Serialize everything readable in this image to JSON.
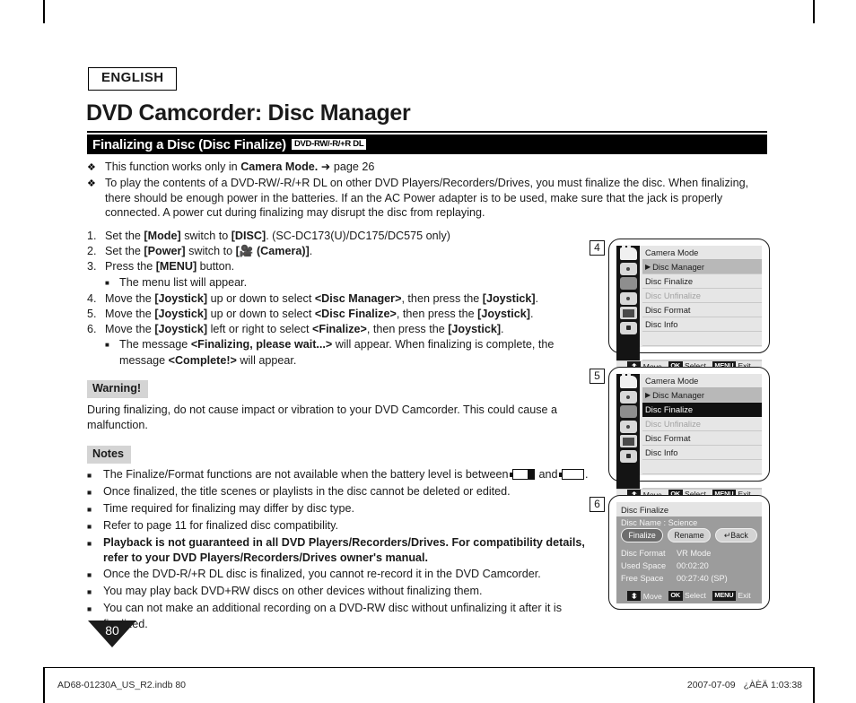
{
  "language_tag": "ENGLISH",
  "page_title": "DVD Camcorder: Disc Manager",
  "section": {
    "title": "Finalizing a Disc (Disc Finalize)",
    "disc_badge": "DVD-RW/-R/+R DL"
  },
  "intro": [
    {
      "parts": [
        {
          "t": "This function works only in ",
          "b": false
        },
        {
          "t": "Camera Mode.",
          "b": true
        },
        {
          "t": " ➜ page 26",
          "b": false
        }
      ]
    },
    {
      "parts": [
        {
          "t": "To play the contents of a DVD-RW/-R/+R DL on other DVD Players/Recorders/Drives, you must finalize the disc. When finalizing, there should be enough power in the batteries. If an the AC Power adapter is to be used, make sure that the jack is properly connected. A power cut during finalizing may disrupt the disc from replaying.",
          "b": false
        }
      ]
    }
  ],
  "steps": [
    {
      "num": "1.",
      "parts": [
        {
          "t": "Set the ",
          "b": false
        },
        {
          "t": "[Mode]",
          "b": true
        },
        {
          "t": " switch to ",
          "b": false
        },
        {
          "t": "[DISC]",
          "b": true
        },
        {
          "t": ". (SC-DC173(U)/DC175/DC575 only)",
          "b": false
        }
      ]
    },
    {
      "num": "2.",
      "parts": [
        {
          "t": "Set the ",
          "b": false
        },
        {
          "t": "[Power]",
          "b": true
        },
        {
          "t": " switch to ",
          "b": false
        },
        {
          "t": "[🎥 (Camera)]",
          "b": true
        },
        {
          "t": ".",
          "b": false
        }
      ]
    },
    {
      "num": "3.",
      "parts": [
        {
          "t": "Press the ",
          "b": false
        },
        {
          "t": "[MENU]",
          "b": true
        },
        {
          "t": " button.",
          "b": false
        }
      ],
      "sub": [
        {
          "parts": [
            {
              "t": "The menu list will appear.",
              "b": false
            }
          ]
        }
      ]
    },
    {
      "num": "4.",
      "parts": [
        {
          "t": "Move the ",
          "b": false
        },
        {
          "t": "[Joystick]",
          "b": true
        },
        {
          "t": " up or down to select ",
          "b": false
        },
        {
          "t": "<Disc Manager>",
          "b": true
        },
        {
          "t": ", then press the ",
          "b": false
        },
        {
          "t": "[Joystick]",
          "b": true
        },
        {
          "t": ".",
          "b": false
        }
      ]
    },
    {
      "num": "5.",
      "parts": [
        {
          "t": "Move the ",
          "b": false
        },
        {
          "t": "[Joystick]",
          "b": true
        },
        {
          "t": " up or down to select ",
          "b": false
        },
        {
          "t": "<Disc Finalize>",
          "b": true
        },
        {
          "t": ", then press the ",
          "b": false
        },
        {
          "t": "[Joystick]",
          "b": true
        },
        {
          "t": ".",
          "b": false
        }
      ]
    },
    {
      "num": "6.",
      "parts": [
        {
          "t": "Move the ",
          "b": false
        },
        {
          "t": "[Joystick]",
          "b": true
        },
        {
          "t": " left or right to select ",
          "b": false
        },
        {
          "t": "<Finalize>",
          "b": true
        },
        {
          "t": ", then press the ",
          "b": false
        },
        {
          "t": "[Joystick]",
          "b": true
        },
        {
          "t": ".",
          "b": false
        }
      ],
      "sub": [
        {
          "parts": [
            {
              "t": "The message ",
              "b": false
            },
            {
              "t": "<Finalizing, please wait...>",
              "b": true
            },
            {
              "t": " will appear. When finalizing is complete, the message ",
              "b": false
            },
            {
              "t": "<Complete!>",
              "b": true
            },
            {
              "t": " will appear.",
              "b": false
            }
          ]
        }
      ]
    }
  ],
  "warning": {
    "label": "Warning!",
    "text": "During finalizing, do not cause impact or vibration to your DVD Camcorder. This could cause a malfunction."
  },
  "notes": {
    "label": "Notes",
    "items": [
      {
        "parts": [
          {
            "t": "The Finalize/Format functions are not available when the battery level is between ",
            "b": false
          },
          {
            "icon": "battery-half-icon"
          },
          {
            "t": " and ",
            "b": false
          },
          {
            "icon": "battery-empty-icon"
          },
          {
            "t": ".",
            "b": false
          }
        ]
      },
      {
        "parts": [
          {
            "t": "Once finalized, the title scenes or playlists in the disc cannot be deleted or edited.",
            "b": false
          }
        ]
      },
      {
        "parts": [
          {
            "t": "Time required for finalizing may differ by disc type.",
            "b": false
          }
        ]
      },
      {
        "parts": [
          {
            "t": "Refer to page 11 for finalized disc compatibility.",
            "b": false
          }
        ]
      },
      {
        "parts": [
          {
            "t": "Playback is not guaranteed in all DVD Players/Recorders/Drives. For compatibility details, refer to your DVD Players/Recorders/Drives owner's manual.",
            "b": true
          }
        ]
      },
      {
        "parts": [
          {
            "t": "Once the DVD-R/+R DL disc is finalized, you cannot re-record it in the DVD Camcorder.",
            "b": false
          }
        ]
      },
      {
        "parts": [
          {
            "t": "You may play back DVD+RW discs on other devices without finalizing them.",
            "b": false
          }
        ]
      },
      {
        "parts": [
          {
            "t": "You can not make an additional recording on a DVD-RW disc without unfinalizing it after it is finalized.",
            "b": false
          }
        ]
      }
    ]
  },
  "screens": [
    {
      "step": "4",
      "type": "menu",
      "header": "Camera Mode",
      "rows": [
        {
          "label": "Disc Manager",
          "state": "selected-grey",
          "caret": true
        },
        {
          "label": "Disc Finalize",
          "state": "normal"
        },
        {
          "label": "Disc Unfinalize",
          "state": "dim"
        },
        {
          "label": "Disc Format",
          "state": "normal"
        },
        {
          "label": "Disc Info",
          "state": "normal"
        },
        {
          "label": "",
          "state": "blank"
        },
        {
          "label": "",
          "state": "blank"
        }
      ],
      "footer": [
        {
          "key": "dpad",
          "label": "Move"
        },
        {
          "key": "OK",
          "label": "Select"
        },
        {
          "key": "MENU",
          "label": "Exit"
        }
      ]
    },
    {
      "step": "5",
      "type": "menu",
      "header": "Camera Mode",
      "rows": [
        {
          "label": "Disc Manager",
          "state": "selected-grey",
          "caret": true
        },
        {
          "label": "Disc Finalize",
          "state": "selected-black"
        },
        {
          "label": "Disc Unfinalize",
          "state": "dim"
        },
        {
          "label": "Disc Format",
          "state": "normal"
        },
        {
          "label": "Disc Info",
          "state": "normal"
        },
        {
          "label": "",
          "state": "blank"
        },
        {
          "label": "",
          "state": "blank"
        }
      ],
      "footer": [
        {
          "key": "dpad",
          "label": "Move"
        },
        {
          "key": "OK",
          "label": "Select"
        },
        {
          "key": "MENU",
          "label": "Exit"
        }
      ]
    },
    {
      "step": "6",
      "type": "info",
      "header": "Disc Finalize",
      "disc_name": "Disc Name : Science",
      "buttons": [
        {
          "label": "Finalize",
          "active": true
        },
        {
          "label": "Rename",
          "active": false
        },
        {
          "label": "↵Back",
          "active": false
        }
      ],
      "info_rows": [
        {
          "key": "Disc Format",
          "value": "VR Mode"
        },
        {
          "key": "Used Space",
          "value": "00:02:20"
        },
        {
          "key": "Free Space",
          "value": "00:27:40 (SP)"
        }
      ],
      "footer": [
        {
          "key": "dpad",
          "label": "Move"
        },
        {
          "key": "OK",
          "label": "Select"
        },
        {
          "key": "MENU",
          "label": "Exit"
        }
      ]
    }
  ],
  "page_number": "80",
  "footer": {
    "left": "AD68-01230A_US_R2.indb   80",
    "date": "2007-07-09",
    "time": "¿ÀÈÄ 1:03:38"
  }
}
